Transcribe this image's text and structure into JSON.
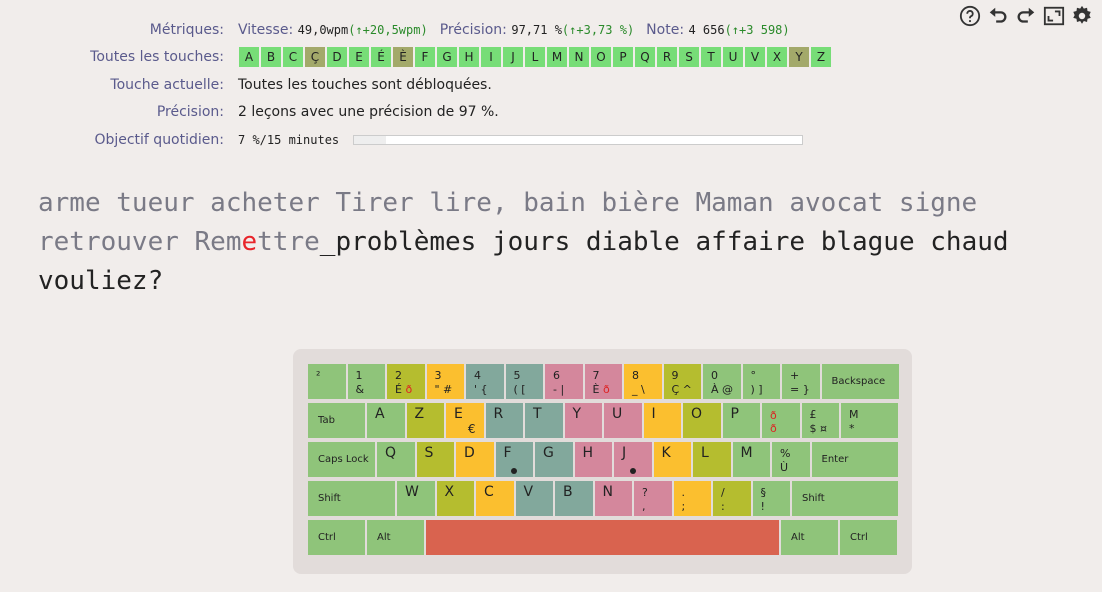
{
  "toolbar": {
    "icons": [
      "help-icon",
      "undo-icon",
      "redo-icon",
      "fullscreen-icon",
      "gear-icon"
    ]
  },
  "labels": {
    "metrics": "Métriques:",
    "all_keys": "Toutes les touches:",
    "current_key": "Touche actuelle:",
    "accuracy": "Précision:",
    "daily_goal": "Objectif quotidien:"
  },
  "metrics": {
    "speed_label": "Vitesse:",
    "speed_value": "49,0wpm",
    "speed_delta": "(↑+20,5wpm)",
    "accuracy_label": "Précision:",
    "accuracy_value": "97,71 %",
    "accuracy_delta": "(↑+3,73 %)",
    "score_label": "Note:",
    "score_value": "4 656",
    "score_delta": "(↑+3 598)"
  },
  "all_keys": [
    "A",
    "B",
    "C",
    "Ç",
    "D",
    "E",
    "É",
    "È",
    "F",
    "G",
    "H",
    "I",
    "J",
    "L",
    "M",
    "N",
    "O",
    "P",
    "Q",
    "R",
    "S",
    "T",
    "U",
    "V",
    "X",
    "Y",
    "Z"
  ],
  "all_keys_colors": {
    "green": "#77dd77",
    "olive": "#a3a96a",
    "lime": "#9ccb6b"
  },
  "current_key_text": "Toutes les touches sont débloquées.",
  "accuracy_text": "2 leçons avec une précision de 97 %.",
  "daily_goal_text": "7 %/15 minutes",
  "daily_goal_fraction": 0.07,
  "text": {
    "done1": "arme tueur acheter Tirer lire, bain bière Maman avocat signe",
    "done2": "retrouver Rem",
    "error": "e",
    "done3": "ttre",
    "cursor": "_",
    "todo": "problèmes jours diable affaire blague chaud",
    "todo2": "vouliez?"
  },
  "keyboard": {
    "row1": [
      {
        "t": "²",
        "b": ""
      },
      {
        "t": "1",
        "b": "&"
      },
      {
        "t": "2",
        "b": "É ð"
      },
      {
        "t": "3",
        "b": "\" #"
      },
      {
        "t": "4",
        "b": "' {"
      },
      {
        "t": "5",
        "b": "( ["
      },
      {
        "t": "6",
        "b": "- |"
      },
      {
        "t": "7",
        "b": "È ð"
      },
      {
        "t": "8",
        "b": "_ \\"
      },
      {
        "t": "9",
        "b": "Ç ^"
      },
      {
        "t": "0",
        "b": "À @"
      },
      {
        "t": "°",
        "b": ") ]"
      },
      {
        "t": "+",
        "b": "= }"
      },
      {
        "t": "Backspace",
        "b": ""
      }
    ],
    "row2": [
      "Tab",
      "A",
      "Z",
      "E",
      "R",
      "T",
      "Y",
      "U",
      "I",
      "O",
      "P",
      "ð ð",
      "£ $ ¤",
      "M *"
    ],
    "row3": [
      "Caps Lock",
      "Q",
      "S",
      "D",
      "F",
      "G",
      "H",
      "J",
      "K",
      "L",
      "M",
      "% Ù",
      "Enter"
    ],
    "row4": [
      "Shift",
      "W",
      "X",
      "C",
      "V",
      "B",
      "N",
      "? ,",
      ". ;",
      "/ :",
      "§ !",
      "Shift"
    ],
    "row5": [
      "Ctrl",
      "Alt",
      "",
      "Alt",
      "Ctrl"
    ],
    "euro": "€"
  },
  "colors": {
    "green": "#8fc47a",
    "olive": "#b5bd2f",
    "orange": "#fbbf2f",
    "teal": "#82a89c",
    "pink": "#d4879c",
    "space": "#d9634f"
  }
}
